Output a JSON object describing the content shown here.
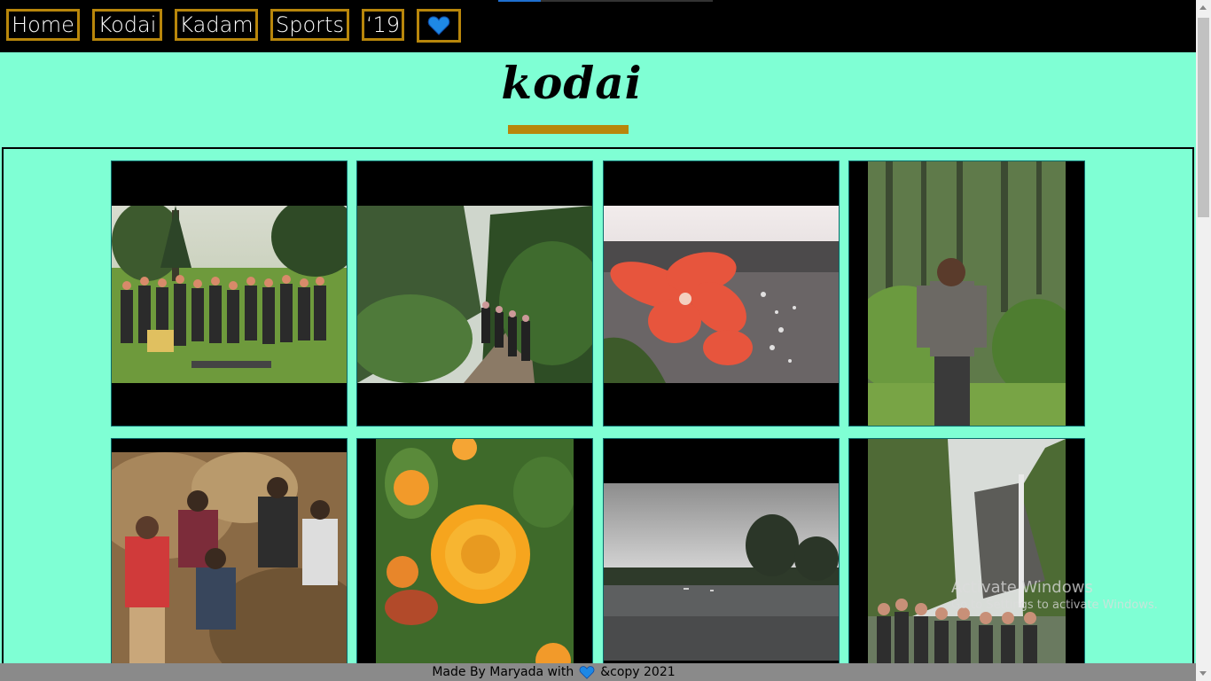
{
  "nav": {
    "items": [
      {
        "label": "Home"
      },
      {
        "label": "Kodai"
      },
      {
        "label": "Kadam"
      },
      {
        "label": "Sports"
      },
      {
        "label": "‘19"
      }
    ],
    "heart_icon": "heart-icon",
    "progress": 0.2
  },
  "page": {
    "title": "kodai"
  },
  "colors": {
    "background": "#7fffd4",
    "accent": "#b8860b",
    "heart": "#1e88e5"
  },
  "footer": {
    "text_before": "Made By Maryada with",
    "text_after": "&copy 2021"
  },
  "watermark": {
    "title": "Activate Windows",
    "subtitle": "Go to Settings to activate Windows."
  }
}
